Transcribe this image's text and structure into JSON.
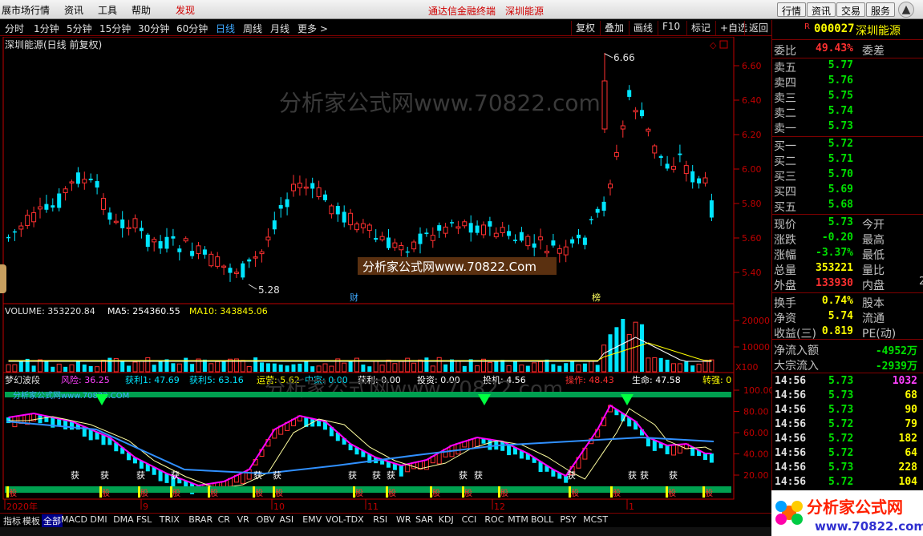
{
  "menu": {
    "items": [
      "展市场行情",
      "资讯",
      "工具",
      "帮助"
    ],
    "discover": "发现",
    "center_title": "通达信金融终端",
    "center_stock": "深圳能源",
    "right_buttons": [
      "行情",
      "资讯",
      "交易",
      "服务"
    ],
    "close_symbol": "▲"
  },
  "periods": [
    "分时",
    "1分钟",
    "5分钟",
    "15分钟",
    "30分钟",
    "60分钟",
    "日线",
    "周线",
    "月线",
    "更多 >"
  ],
  "active_period": "日线",
  "tools": [
    "复权",
    "叠加",
    "画线",
    "F10",
    "标记",
    "+自选",
    "返回"
  ],
  "chart": {
    "title": "深圳能源(日线 前复权)",
    "high_label": "6.66",
    "low_label": "5.28",
    "watermark": "分析家公式网www.70822.com",
    "watermark_box": "分析家公式网www.70822.Com",
    "marker_cai": "财",
    "marker_bang": "榜",
    "y_ticks": [
      "6.60",
      "6.40",
      "6.20",
      "6.00",
      "5.80",
      "5.60",
      "5.40"
    ],
    "volume_label": "VOLUME: 353220.84",
    "ma5_label": "MA5: 254360.55",
    "ma10_label": "MA10: 343845.06",
    "vol_ticks": [
      "20000",
      "10000"
    ],
    "vol_unit": "X100",
    "indicator_name": "梦幻波段",
    "ind_labels": {
      "risk": "风险: 36.25",
      "profit1": "获利1: 47.69",
      "profit5": "获利5: 63.16",
      "operate": "运营: 5.62",
      "zhongjia": "中家: 0.00",
      "profit": "获利: 0.00",
      "invest": "投资: 0.00",
      "spec": "投机: 4.56",
      "op2": "操作: 48.43",
      "life": "生命: 47.58",
      "strong": "转强: 0"
    },
    "ind_watermark": "分析家公式网www.70822.COM",
    "ind_ticks": [
      "100.00",
      "80.00",
      "60.00",
      "40.00",
      "20.00"
    ],
    "huo_label": "获",
    "gu_label": "股",
    "date_labels": [
      "2020年",
      "9",
      "10",
      "11",
      "12",
      "1"
    ]
  },
  "quote": {
    "code": "000027",
    "name": "深圳能源",
    "r_tag": "R",
    "weibi_label": "委比",
    "weibi_val": "49.43%",
    "weicha_label": "委差",
    "sells": [
      {
        "label": "卖五",
        "price": "5.77"
      },
      {
        "label": "卖四",
        "price": "5.76"
      },
      {
        "label": "卖三",
        "price": "5.75"
      },
      {
        "label": "卖二",
        "price": "5.74"
      },
      {
        "label": "卖一",
        "price": "5.73"
      }
    ],
    "buys": [
      {
        "label": "买一",
        "price": "5.72"
      },
      {
        "label": "买二",
        "price": "5.71"
      },
      {
        "label": "买三",
        "price": "5.70"
      },
      {
        "label": "买四",
        "price": "5.69"
      },
      {
        "label": "买五",
        "price": "5.68"
      }
    ],
    "stats": [
      {
        "label": "现价",
        "value": "5.73",
        "color": "#00e000",
        "label2": "今开"
      },
      {
        "label": "涨跌",
        "value": "-0.20",
        "color": "#00e000",
        "label2": "最高"
      },
      {
        "label": "涨幅",
        "value": "-3.37%",
        "color": "#00e000",
        "label2": "最低"
      },
      {
        "label": "总量",
        "value": "353221",
        "color": "#ffff00",
        "label2": "量比"
      },
      {
        "label": "外盘",
        "value": "133930",
        "color": "#ff3030",
        "label2": "内盘"
      }
    ],
    "inner_partial": "2",
    "stats2": [
      {
        "label": "换手",
        "value": "0.74%",
        "color": "#ffff00",
        "label2": "股本"
      },
      {
        "label": "净资",
        "value": "5.74",
        "color": "#ffff00",
        "label2": "流通"
      },
      {
        "label": "收益(三)",
        "value": "0.819",
        "color": "#ffff00",
        "label2": "PE(动)"
      }
    ],
    "flow": [
      {
        "label": "净流入额",
        "value": "-4952万"
      },
      {
        "label": "大宗流入",
        "value": "-2939万"
      }
    ],
    "ticks": [
      {
        "time": "14:56",
        "price": "5.73",
        "vol": "1032",
        "color": "#ff40ff"
      },
      {
        "time": "14:56",
        "price": "5.73",
        "vol": "68",
        "color": "#ffff00"
      },
      {
        "time": "14:56",
        "price": "5.73",
        "vol": "90",
        "color": "#ffff00"
      },
      {
        "time": "14:56",
        "price": "5.72",
        "vol": "79",
        "color": "#ffff00"
      },
      {
        "time": "14:56",
        "price": "5.72",
        "vol": "182",
        "color": "#ffff00"
      },
      {
        "time": "14:56",
        "price": "5.72",
        "vol": "64",
        "color": "#ffff00"
      },
      {
        "time": "14:56",
        "price": "5.73",
        "vol": "228",
        "color": "#ffff00"
      },
      {
        "time": "14:56",
        "price": "5.72",
        "vol": "104",
        "color": "#ffff00"
      }
    ],
    "daily_label": "日线"
  },
  "tabs": [
    "指标",
    "模板",
    "全部",
    "MACD",
    "DMI",
    "DMA",
    "FSL",
    "TRIX",
    "BRAR",
    "CR",
    "VR",
    "OBV",
    "ASI",
    "EMV",
    "VOL-TDX",
    "RSI",
    "WR",
    "SAR",
    "KDJ",
    "CCI",
    "ROC",
    "MTM",
    "BOLL",
    "PSY",
    "MCST"
  ],
  "active_tab": "全部",
  "logo": {
    "text": "分析家公式网",
    "url": "www.70822.com"
  },
  "colors": {
    "up": "#ff3030",
    "down": "#00e5ff",
    "axis": "#c00000",
    "ma_white": "#ffffff",
    "ma_yellow": "#ffff00",
    "magenta": "#ff00ff"
  }
}
